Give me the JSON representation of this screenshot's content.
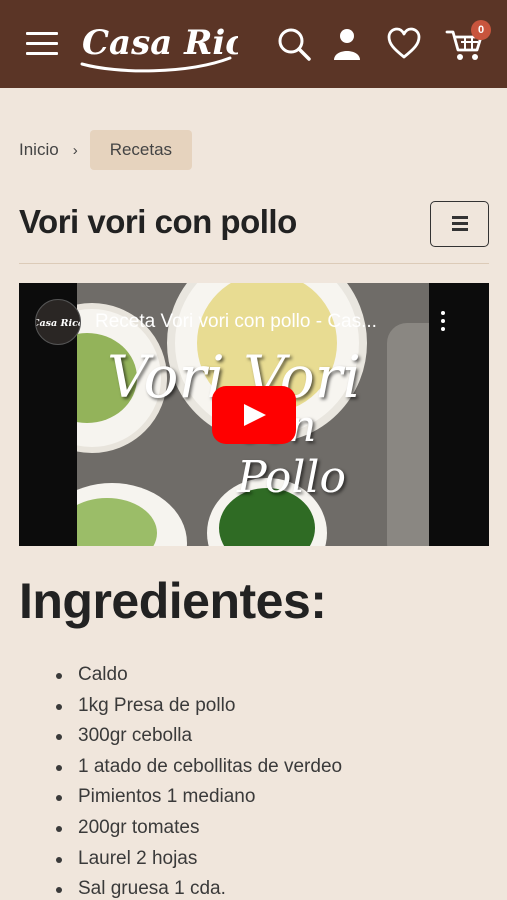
{
  "header": {
    "brand": "Casa Rica",
    "cart_count": "0"
  },
  "breadcrumb": {
    "home": "Inicio",
    "separator": "›",
    "current": "Recetas"
  },
  "page": {
    "title": "Vori vori con pollo"
  },
  "video": {
    "channel_badge": "Casa Rica",
    "title": "Receta Vori vori con pollo - Cas...",
    "overlay_line1": "Vori Vori",
    "overlay_line2": "con Pollo"
  },
  "ingredients": {
    "title": "Ingredientes:",
    "items": [
      "Caldo",
      "1kg Presa de pollo",
      "300gr cebolla",
      "1 atado de cebollitas de verdeo",
      "Pimientos 1 mediano",
      "200gr tomates",
      "Laurel 2 hojas",
      "Sal gruesa 1 cda."
    ]
  },
  "colors": {
    "header_bg": "#5b3526",
    "page_bg": "#f0e6dc",
    "breadcrumb_active_bg": "#e6d3be",
    "badge": "#c8553d",
    "youtube_red": "#ff0000"
  }
}
